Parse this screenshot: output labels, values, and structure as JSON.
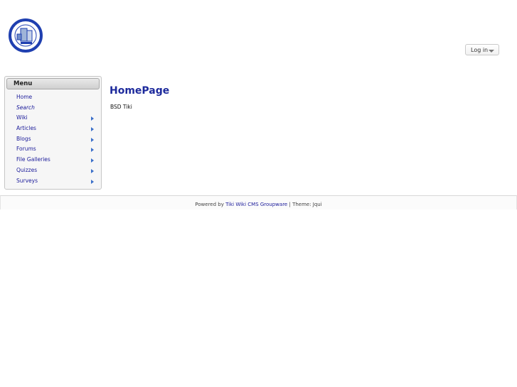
{
  "header": {
    "logo_alt": "CI Services",
    "login_label": "Log in"
  },
  "menu": {
    "title": "Menu",
    "items": [
      {
        "label": "Home",
        "italic": false,
        "submenu": false
      },
      {
        "label": "Search",
        "italic": true,
        "submenu": false
      },
      {
        "label": "Wiki",
        "italic": false,
        "submenu": true
      },
      {
        "label": "Articles",
        "italic": false,
        "submenu": true
      },
      {
        "label": "Blogs",
        "italic": false,
        "submenu": true
      },
      {
        "label": "Forums",
        "italic": false,
        "submenu": true
      },
      {
        "label": "File Galleries",
        "italic": false,
        "submenu": true
      },
      {
        "label": "Quizzes",
        "italic": false,
        "submenu": true
      },
      {
        "label": "Surveys",
        "italic": false,
        "submenu": true
      }
    ]
  },
  "main": {
    "title": "HomePage",
    "content": "BSD Tiki"
  },
  "footer": {
    "powered_prefix": "Powered by",
    "powered_link": "Tiki Wiki CMS Groupware",
    "separator": "|",
    "theme_text": "Theme: Jqui"
  },
  "colors": {
    "link": "#1b1b9a",
    "title": "#1d2a9c",
    "submenu_arrow": "#3b6fc9",
    "logo_blue": "#1f3fb0"
  }
}
